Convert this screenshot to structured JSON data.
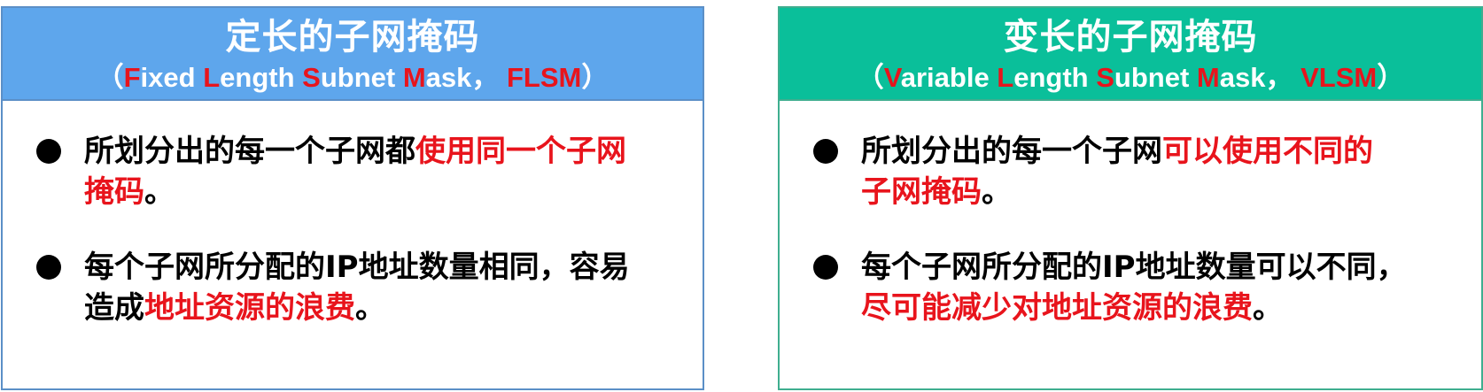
{
  "left_card": {
    "title": "定长的子网掩码",
    "subtitle": {
      "open": "（",
      "w1_initial": "F",
      "w1_rest": "ixed ",
      "w2_initial": "L",
      "w2_rest": "ength ",
      "w3_initial": "S",
      "w3_rest": "ubnet ",
      "w4_initial": "M",
      "w4_rest": "ask， ",
      "abbr": "FLSM",
      "close": "）"
    },
    "bullets": [
      {
        "line1_normal": "所划分出的每一个子网都",
        "line1_red": "使用同一个子网",
        "line2_red": "掩码",
        "line2_normal": "。"
      },
      {
        "line1_normal": "每个子网所分配的IP地址数量相同，容易",
        "line2_normal": "造成",
        "line2_red": "地址资源的浪费",
        "line2_tail": "。"
      }
    ]
  },
  "right_card": {
    "title": "变长的子网掩码",
    "subtitle": {
      "open": "（",
      "w1_initial": "V",
      "w1_rest": "ariable ",
      "w2_initial": "L",
      "w2_rest": "ength ",
      "w3_initial": "S",
      "w3_rest": "ubnet ",
      "w4_initial": "M",
      "w4_rest": "ask， ",
      "abbr": "VLSM",
      "close": "）"
    },
    "bullets": [
      {
        "line1_normal": "所划分出的每一个子网",
        "line1_red": "可以使用不同的",
        "line2_red": "子网掩码",
        "line2_normal": "。"
      },
      {
        "line1_normal": "每个子网所分配的IP地址数量可以不同，",
        "line2_red": "尽可能减少对地址资源的浪费",
        "line2_tail": "。"
      }
    ]
  },
  "colors": {
    "left_header": "#5ea6ec",
    "right_header": "#0abf9a",
    "emphasis_red": "#e8141c"
  }
}
